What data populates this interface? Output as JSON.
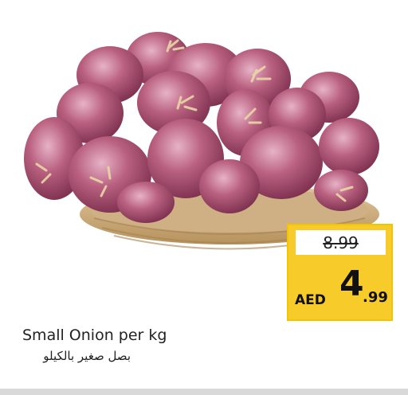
{
  "product": {
    "name_en": "Small Onion per kg",
    "name_ar": "بصل صغير بالكيلو",
    "image": "small-red-onions-in-wicker-basket"
  },
  "price": {
    "old": "8.99",
    "currency": "AED",
    "integer": "4",
    "decimal": ".99"
  },
  "colors": {
    "tag_yellow": "#f7cc2a",
    "onion_purple": "#a8506f",
    "basket": "#c9a873"
  }
}
